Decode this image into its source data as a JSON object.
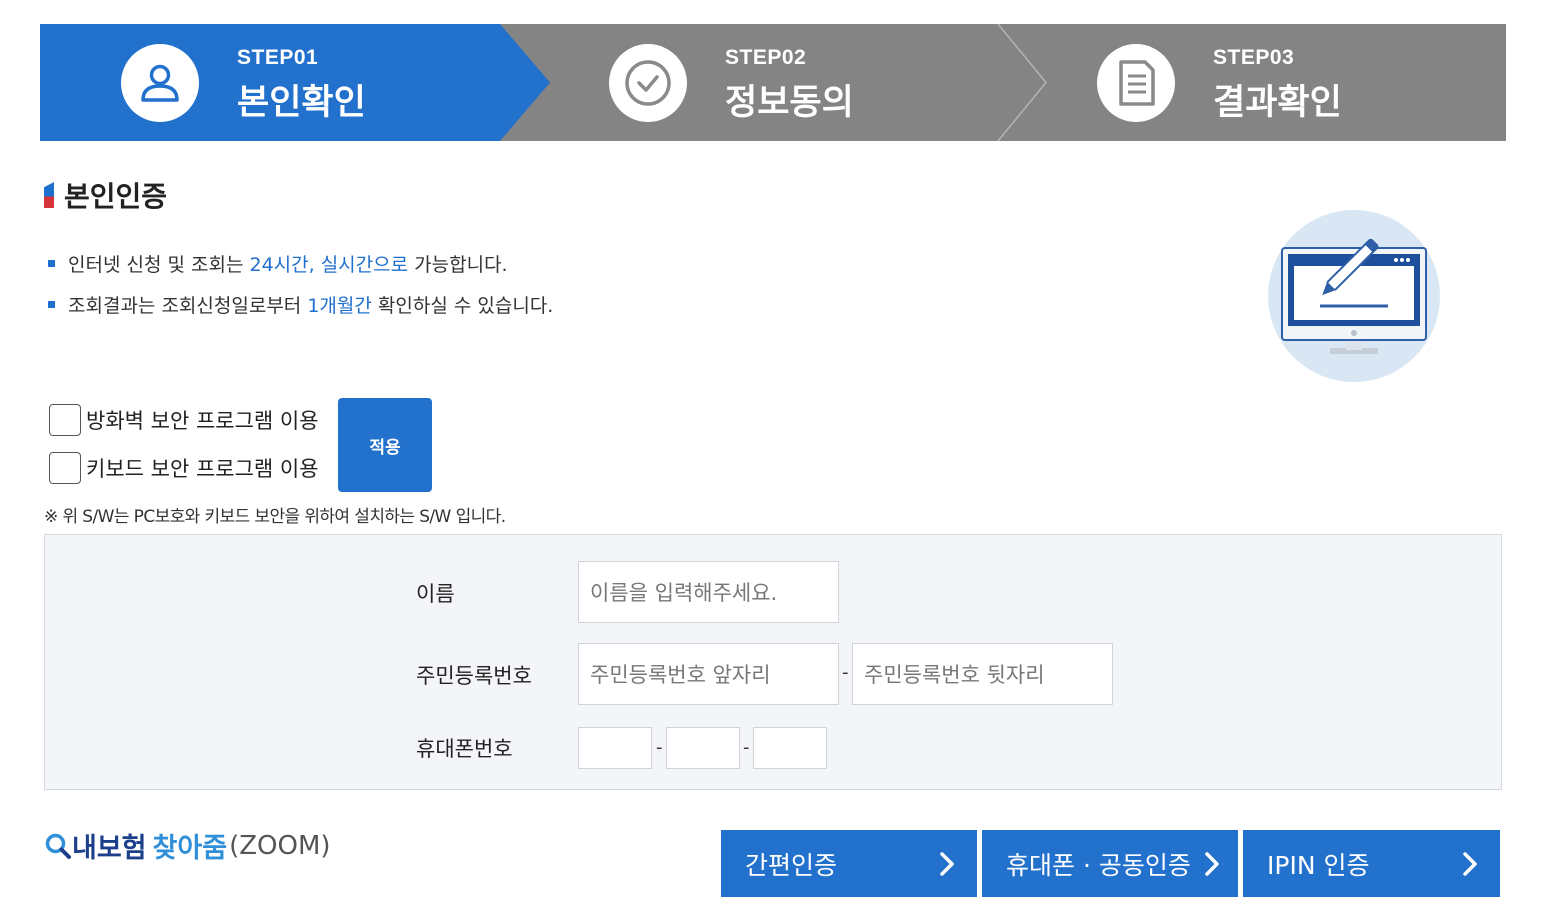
{
  "steps": [
    {
      "num": "STEP01",
      "title": "본인확인",
      "icon": "user-icon",
      "active": true
    },
    {
      "num": "STEP02",
      "title": "정보동의",
      "icon": "check-circle-icon",
      "active": false
    },
    {
      "num": "STEP03",
      "title": "결과확인",
      "icon": "document-icon",
      "active": false
    }
  ],
  "colors": {
    "accent": "#2271cc",
    "inactive_step": "#848484",
    "form_bg": "#f3f5f8",
    "marker_red": "#d6333b"
  },
  "section": {
    "title": "본인인증"
  },
  "notices": [
    {
      "pre": "인터넷 신청 및 조회는 ",
      "hl": "24시간, 실시간으로",
      "post": " 가능합니다."
    },
    {
      "pre": "조회결과는 조회신청일로부터 ",
      "hl": "1개월간",
      "post": " 확인하실 수 있습니다."
    }
  ],
  "security": {
    "option1": "방화벽 보안 프로그램 이용",
    "option2": "키보드 보안 프로그램 이용",
    "apply": "적용",
    "note": "※ 위 S/W는 PC보호와 키보드 보안을 위하여 설치하는 S/W 입니다."
  },
  "form": {
    "name_label": "이름",
    "name_placeholder": "이름을 입력해주세요.",
    "rrn_label": "주민등록번호",
    "rrn_front_placeholder": "주민등록번호 앞자리",
    "rrn_back_placeholder": "주민등록번호 뒷자리",
    "phone_label": "휴대폰번호",
    "dash": "-"
  },
  "logo": {
    "part1": "내보험",
    "part2": "찾아줌",
    "part3": "(ZOOM)"
  },
  "auth_buttons": [
    "간편인증",
    "휴대폰 · 공동인증",
    "IPIN 인증"
  ]
}
